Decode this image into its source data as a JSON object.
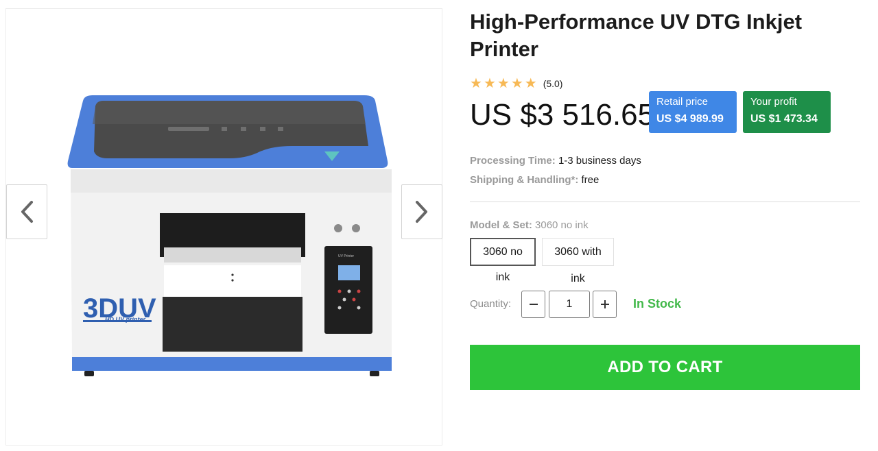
{
  "product": {
    "title": "High-Performance UV DTG Inkjet Printer",
    "rating_value": "(5.0)",
    "stars": 5,
    "image_brand": "3DUV",
    "image_tagline": "HD UV printer",
    "image_panel_text": "UV Printer"
  },
  "pricing": {
    "price": "US $3 516.65",
    "retail_label": "Retail price",
    "retail_value": "US $4 989.99",
    "profit_label": "Your profit",
    "profit_value": "US $1 473.34"
  },
  "details": {
    "processing_label": "Processing Time:",
    "processing_value": "1-3 business days",
    "shipping_label": "Shipping & Handling*:",
    "shipping_value": "free"
  },
  "model": {
    "label": "Model & Set:",
    "selected": "3060 no ink",
    "options": [
      "3060 no ink",
      "3060 with ink"
    ]
  },
  "quantity": {
    "label": "Quantity:",
    "value": "1",
    "stock": "In Stock"
  },
  "cart": {
    "label": "ADD TO CART"
  },
  "gallery": {
    "prev_icon": "chevron-left-icon",
    "next_icon": "chevron-right-icon"
  },
  "colors": {
    "retail_badge": "#3f87e6",
    "profit_badge": "#1e8f49",
    "add_to_cart": "#2dc43a",
    "in_stock": "#42b84a",
    "star": "#f7b955"
  }
}
